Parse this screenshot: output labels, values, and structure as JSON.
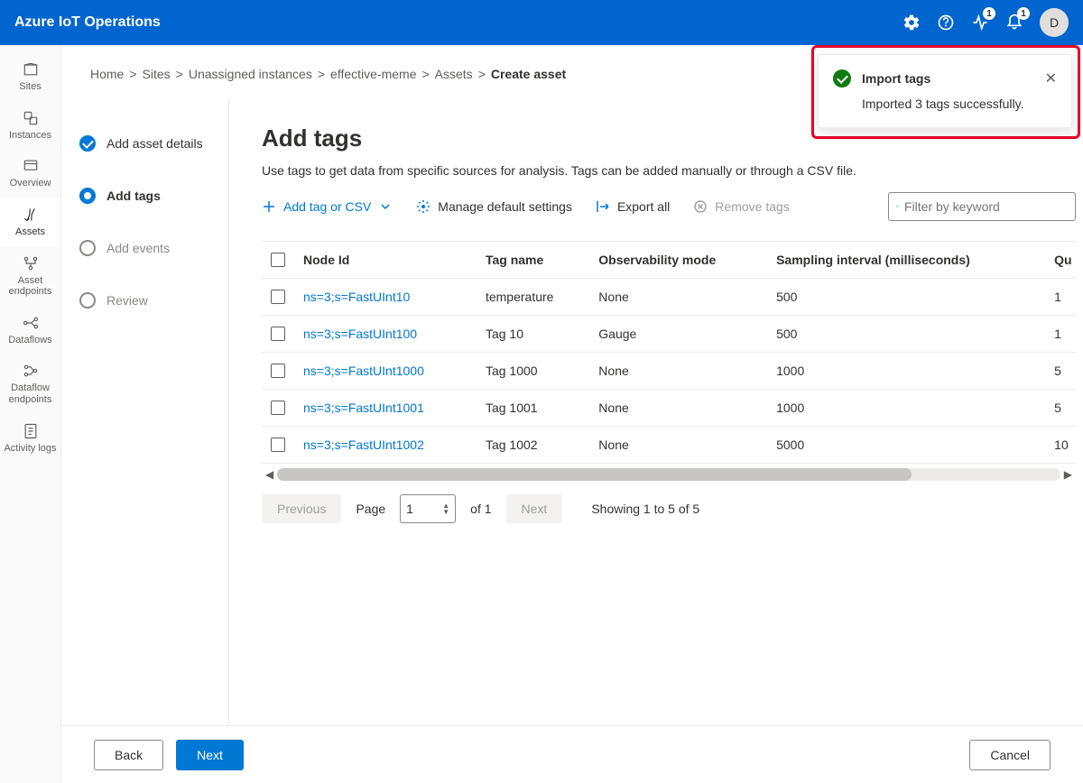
{
  "header": {
    "title": "Azure IoT Operations",
    "badge1": "1",
    "badge2": "1",
    "avatar": "D"
  },
  "rail": {
    "items": [
      {
        "label": "Sites"
      },
      {
        "label": "Instances"
      },
      {
        "label": "Overview"
      },
      {
        "label": "Assets"
      },
      {
        "label": "Asset endpoints"
      },
      {
        "label": "Dataflows"
      },
      {
        "label": "Dataflow endpoints"
      },
      {
        "label": "Activity logs"
      }
    ]
  },
  "crumbs": {
    "c0": "Home",
    "c1": "Sites",
    "c2": "Unassigned instances",
    "c3": "effective-meme",
    "c4": "Assets",
    "c5": "Create asset"
  },
  "steps": {
    "s0": "Add asset details",
    "s1": "Add tags",
    "s2": "Add events",
    "s3": "Review"
  },
  "page": {
    "title": "Add tags",
    "desc": "Use tags to get data from specific sources for analysis. Tags can be added manually or through a CSV file."
  },
  "toolbar": {
    "add": "Add tag or CSV",
    "manage": "Manage default settings",
    "export": "Export all",
    "remove": "Remove tags",
    "filter_placeholder": "Filter by keyword"
  },
  "table": {
    "headers": {
      "node": "Node Id",
      "tag": "Tag name",
      "obs": "Observability mode",
      "interval": "Sampling interval (milliseconds)",
      "queue": "Qu"
    },
    "rows": [
      {
        "node": "ns=3;s=FastUInt10",
        "tag": "temperature",
        "obs": "None",
        "interval": "500",
        "queue": "1"
      },
      {
        "node": "ns=3;s=FastUInt100",
        "tag": "Tag 10",
        "obs": "Gauge",
        "interval": "500",
        "queue": "1"
      },
      {
        "node": "ns=3;s=FastUInt1000",
        "tag": "Tag 1000",
        "obs": "None",
        "interval": "1000",
        "queue": "5"
      },
      {
        "node": "ns=3;s=FastUInt1001",
        "tag": "Tag 1001",
        "obs": "None",
        "interval": "1000",
        "queue": "5"
      },
      {
        "node": "ns=3;s=FastUInt1002",
        "tag": "Tag 1002",
        "obs": "None",
        "interval": "5000",
        "queue": "10"
      }
    ]
  },
  "pager": {
    "prev": "Previous",
    "next": "Next",
    "page_label": "Page",
    "page_value": "1",
    "of": "of 1",
    "showing": "Showing 1 to 5 of 5"
  },
  "footer": {
    "back": "Back",
    "next": "Next",
    "cancel": "Cancel"
  },
  "toast": {
    "title": "Import tags",
    "body": "Imported 3 tags successfully."
  }
}
